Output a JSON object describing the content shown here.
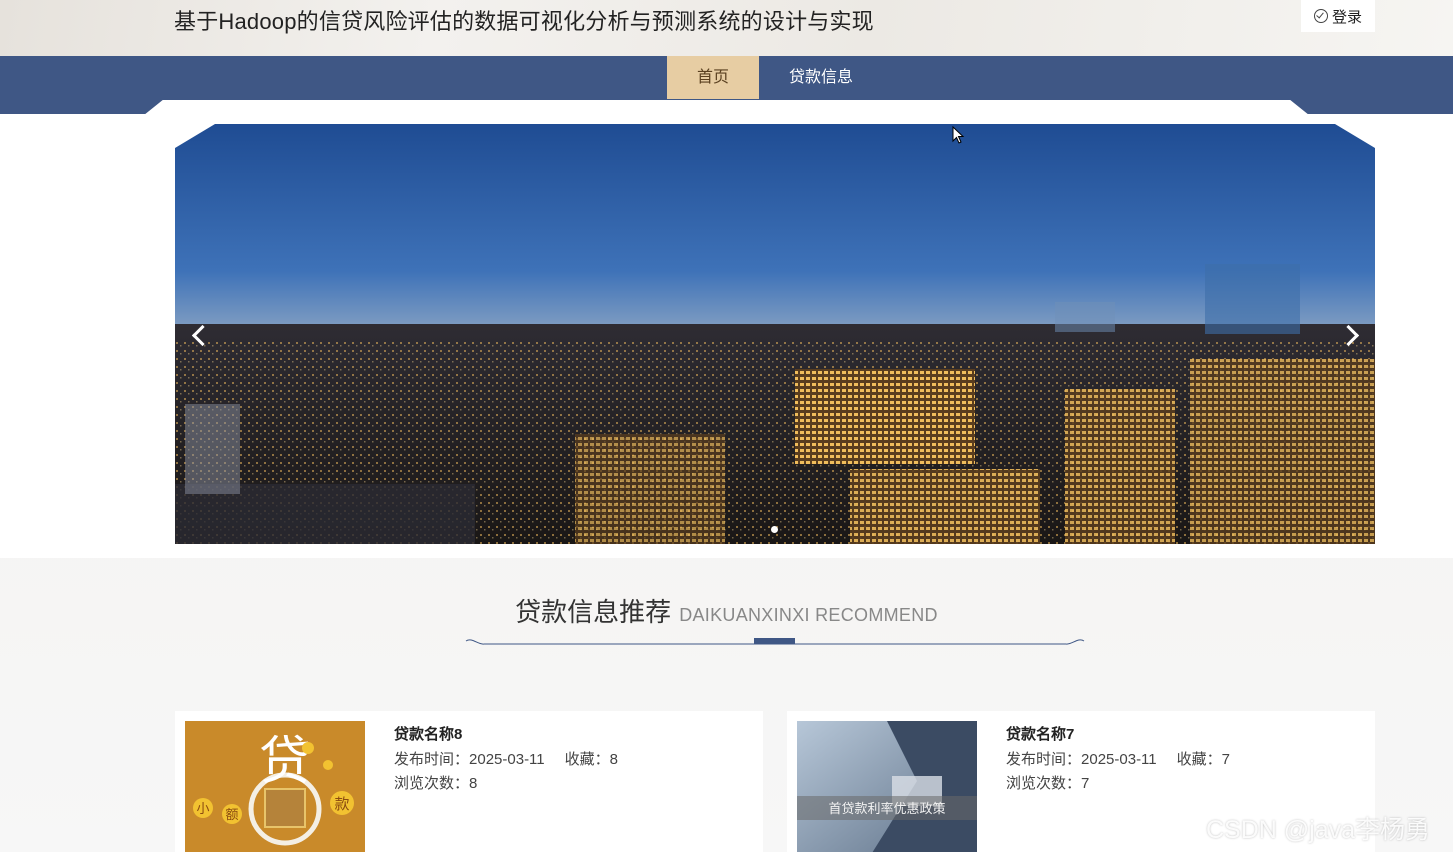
{
  "header": {
    "site_title": "基于Hadoop的信贷风险评估的数据可视化分析与预测系统的设计与实现",
    "login_label": "登录"
  },
  "nav": {
    "home": "首页",
    "loans": "贷款信息"
  },
  "section": {
    "title_cn": "贷款信息推荐",
    "title_en": "DAIKUANXINXI RECOMMEND"
  },
  "cards": [
    {
      "name": "贷款名称8",
      "publish_label": "发布时间：",
      "publish_date": "2025-03-11",
      "fav_label": "收藏：",
      "fav_count": "8",
      "views_label": "浏览次数：",
      "views_count": "8",
      "thumb_text": {
        "big": "贷",
        "left1": "小",
        "left2": "额",
        "right": "款"
      }
    },
    {
      "name": "贷款名称7",
      "publish_label": "发布时间：",
      "publish_date": "2025-03-11",
      "fav_label": "收藏：",
      "fav_count": "7",
      "views_label": "浏览次数：",
      "views_count": "7",
      "thumb_text": {
        "caption": "首贷款利率优惠政策"
      }
    }
  ],
  "watermark": "CSDN @java李杨勇",
  "colors": {
    "nav_bg": "#3f5785",
    "nav_active_bg": "#e7cda3",
    "divider_accent": "#3f5785"
  }
}
